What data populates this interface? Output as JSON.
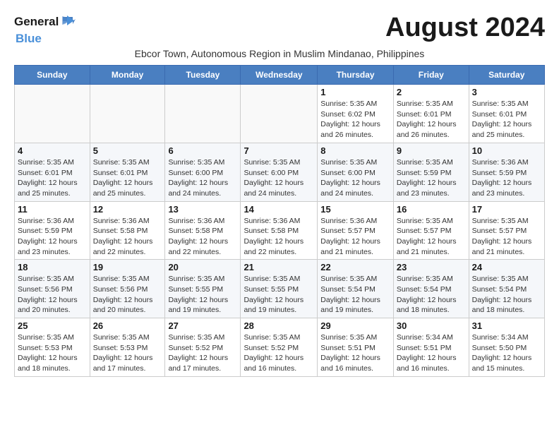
{
  "logo": {
    "line1": "General",
    "line2": "Blue"
  },
  "title": "August 2024",
  "subtitle": "Ebcor Town, Autonomous Region in Muslim Mindanao, Philippines",
  "days_header": [
    "Sunday",
    "Monday",
    "Tuesday",
    "Wednesday",
    "Thursday",
    "Friday",
    "Saturday"
  ],
  "weeks": [
    [
      {
        "day": "",
        "info": ""
      },
      {
        "day": "",
        "info": ""
      },
      {
        "day": "",
        "info": ""
      },
      {
        "day": "",
        "info": ""
      },
      {
        "day": "1",
        "info": "Sunrise: 5:35 AM\nSunset: 6:02 PM\nDaylight: 12 hours and 26 minutes."
      },
      {
        "day": "2",
        "info": "Sunrise: 5:35 AM\nSunset: 6:01 PM\nDaylight: 12 hours and 26 minutes."
      },
      {
        "day": "3",
        "info": "Sunrise: 5:35 AM\nSunset: 6:01 PM\nDaylight: 12 hours and 25 minutes."
      }
    ],
    [
      {
        "day": "4",
        "info": "Sunrise: 5:35 AM\nSunset: 6:01 PM\nDaylight: 12 hours and 25 minutes."
      },
      {
        "day": "5",
        "info": "Sunrise: 5:35 AM\nSunset: 6:01 PM\nDaylight: 12 hours and 25 minutes."
      },
      {
        "day": "6",
        "info": "Sunrise: 5:35 AM\nSunset: 6:00 PM\nDaylight: 12 hours and 24 minutes."
      },
      {
        "day": "7",
        "info": "Sunrise: 5:35 AM\nSunset: 6:00 PM\nDaylight: 12 hours and 24 minutes."
      },
      {
        "day": "8",
        "info": "Sunrise: 5:35 AM\nSunset: 6:00 PM\nDaylight: 12 hours and 24 minutes."
      },
      {
        "day": "9",
        "info": "Sunrise: 5:35 AM\nSunset: 5:59 PM\nDaylight: 12 hours and 23 minutes."
      },
      {
        "day": "10",
        "info": "Sunrise: 5:36 AM\nSunset: 5:59 PM\nDaylight: 12 hours and 23 minutes."
      }
    ],
    [
      {
        "day": "11",
        "info": "Sunrise: 5:36 AM\nSunset: 5:59 PM\nDaylight: 12 hours and 23 minutes."
      },
      {
        "day": "12",
        "info": "Sunrise: 5:36 AM\nSunset: 5:58 PM\nDaylight: 12 hours and 22 minutes."
      },
      {
        "day": "13",
        "info": "Sunrise: 5:36 AM\nSunset: 5:58 PM\nDaylight: 12 hours and 22 minutes."
      },
      {
        "day": "14",
        "info": "Sunrise: 5:36 AM\nSunset: 5:58 PM\nDaylight: 12 hours and 22 minutes."
      },
      {
        "day": "15",
        "info": "Sunrise: 5:36 AM\nSunset: 5:57 PM\nDaylight: 12 hours and 21 minutes."
      },
      {
        "day": "16",
        "info": "Sunrise: 5:35 AM\nSunset: 5:57 PM\nDaylight: 12 hours and 21 minutes."
      },
      {
        "day": "17",
        "info": "Sunrise: 5:35 AM\nSunset: 5:57 PM\nDaylight: 12 hours and 21 minutes."
      }
    ],
    [
      {
        "day": "18",
        "info": "Sunrise: 5:35 AM\nSunset: 5:56 PM\nDaylight: 12 hours and 20 minutes."
      },
      {
        "day": "19",
        "info": "Sunrise: 5:35 AM\nSunset: 5:56 PM\nDaylight: 12 hours and 20 minutes."
      },
      {
        "day": "20",
        "info": "Sunrise: 5:35 AM\nSunset: 5:55 PM\nDaylight: 12 hours and 19 minutes."
      },
      {
        "day": "21",
        "info": "Sunrise: 5:35 AM\nSunset: 5:55 PM\nDaylight: 12 hours and 19 minutes."
      },
      {
        "day": "22",
        "info": "Sunrise: 5:35 AM\nSunset: 5:54 PM\nDaylight: 12 hours and 19 minutes."
      },
      {
        "day": "23",
        "info": "Sunrise: 5:35 AM\nSunset: 5:54 PM\nDaylight: 12 hours and 18 minutes."
      },
      {
        "day": "24",
        "info": "Sunrise: 5:35 AM\nSunset: 5:54 PM\nDaylight: 12 hours and 18 minutes."
      }
    ],
    [
      {
        "day": "25",
        "info": "Sunrise: 5:35 AM\nSunset: 5:53 PM\nDaylight: 12 hours and 18 minutes."
      },
      {
        "day": "26",
        "info": "Sunrise: 5:35 AM\nSunset: 5:53 PM\nDaylight: 12 hours and 17 minutes."
      },
      {
        "day": "27",
        "info": "Sunrise: 5:35 AM\nSunset: 5:52 PM\nDaylight: 12 hours and 17 minutes."
      },
      {
        "day": "28",
        "info": "Sunrise: 5:35 AM\nSunset: 5:52 PM\nDaylight: 12 hours and 16 minutes."
      },
      {
        "day": "29",
        "info": "Sunrise: 5:35 AM\nSunset: 5:51 PM\nDaylight: 12 hours and 16 minutes."
      },
      {
        "day": "30",
        "info": "Sunrise: 5:34 AM\nSunset: 5:51 PM\nDaylight: 12 hours and 16 minutes."
      },
      {
        "day": "31",
        "info": "Sunrise: 5:34 AM\nSunset: 5:50 PM\nDaylight: 12 hours and 15 minutes."
      }
    ]
  ]
}
